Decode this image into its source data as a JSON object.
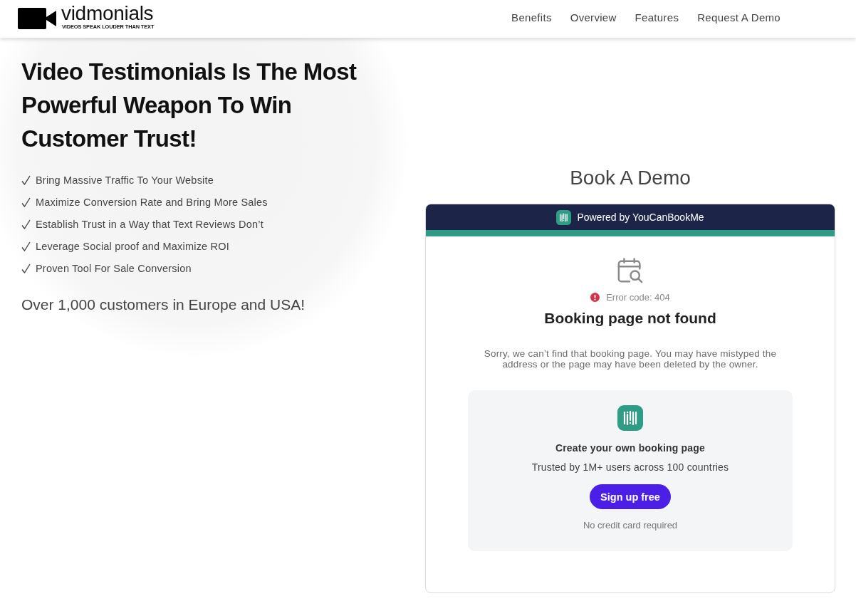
{
  "header": {
    "logo": {
      "wordmark": "vidmonials",
      "tagline": "VIDEOS SPEAK LOUDER THAN TEXT"
    },
    "nav": [
      "Benefits",
      "Overview",
      "Features",
      "Request A Demo"
    ]
  },
  "hero": {
    "headline": "Video Testimonials Is The Most Powerful Weapon To Win Customer Trust!",
    "benefits": [
      "Bring Massive Traffic To Your Website",
      "Maximize Conversion Rate and Bring More Sales",
      "Establish Trust in a Way that Text Reviews Don’t",
      "Leverage Social proof and Maximize ROI",
      "Proven Tool For Sale Conversion"
    ],
    "customers_note": "Over 1,000 customers in Europe and USA!"
  },
  "booking": {
    "title": "Book A Demo",
    "widget": {
      "powered_by": "Powered by YouCanBookMe",
      "error_code": "Error code: 404",
      "error_title": "Booking page not found",
      "error_message": "Sorry, we can’t find that booking page. You may have mistyped the address or the page may have been deleted by the owner.",
      "promo": {
        "title": "Create your own booking page",
        "subtitle": "Trusted by 1M+ users across 100 countries",
        "button": "Sign up free",
        "note": "No credit card required"
      }
    }
  }
}
